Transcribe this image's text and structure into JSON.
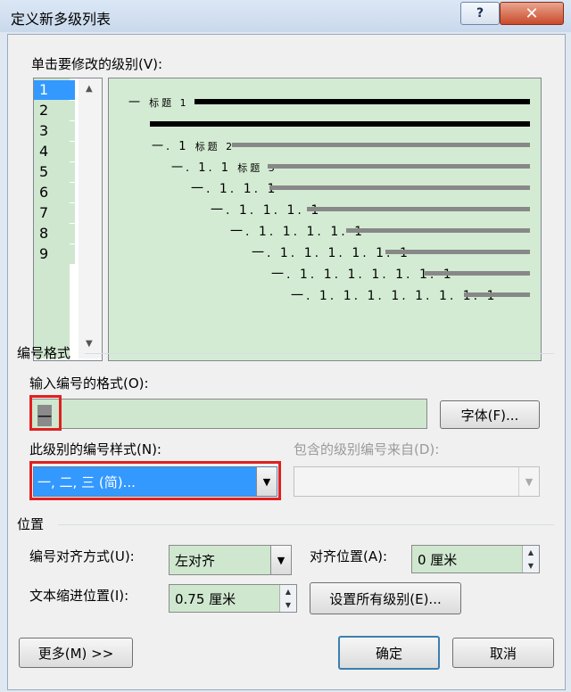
{
  "window": {
    "title": "定义新多级列表",
    "help_label": "?",
    "close_label": "✕"
  },
  "levels_section": {
    "label": "单击要修改的级别(V):",
    "items": [
      "1",
      "2",
      "3",
      "4",
      "5",
      "6",
      "7",
      "8",
      "9"
    ],
    "selected": "1"
  },
  "preview": {
    "rows": [
      {
        "number": "一",
        "style": "标题 1"
      },
      {
        "number": "一. 1",
        "style": "标题 2"
      },
      {
        "number": "一. 1. 1",
        "style": "标题 3"
      },
      {
        "number": "一. 1. 1. 1"
      },
      {
        "number": "一. 1. 1. 1. 1"
      },
      {
        "number": "一. 1. 1. 1. 1. 1"
      },
      {
        "number": "一. 1. 1. 1. 1. 1. 1"
      },
      {
        "number": "一. 1. 1. 1. 1. 1. 1. 1"
      },
      {
        "number": "一. 1. 1. 1. 1. 1. 1. 1. 1"
      }
    ]
  },
  "number_format": {
    "section_label": "编号格式",
    "input_label": "输入编号的格式(O):",
    "input_value": "一",
    "font_button": "字体(F)...",
    "style_label": "此级别的编号样式(N):",
    "style_value": "一, 二, 三 (简)...",
    "include_label": "包含的级别编号来自(D):",
    "include_value": ""
  },
  "position": {
    "section_label": "位置",
    "align_label": "编号对齐方式(U):",
    "align_value": "左对齐",
    "align_at_label": "对齐位置(A):",
    "align_at_value": "0 厘米",
    "indent_label": "文本缩进位置(I):",
    "indent_value": "0.75 厘米",
    "set_all_button": "设置所有级别(E)..."
  },
  "footer": {
    "more_button": "更多(M) >>",
    "ok_button": "确定",
    "cancel_button": "取消"
  },
  "colors": {
    "field_bg": "#cfe7cf",
    "selection": "#3399ff",
    "highlight_border": "#e02020"
  }
}
